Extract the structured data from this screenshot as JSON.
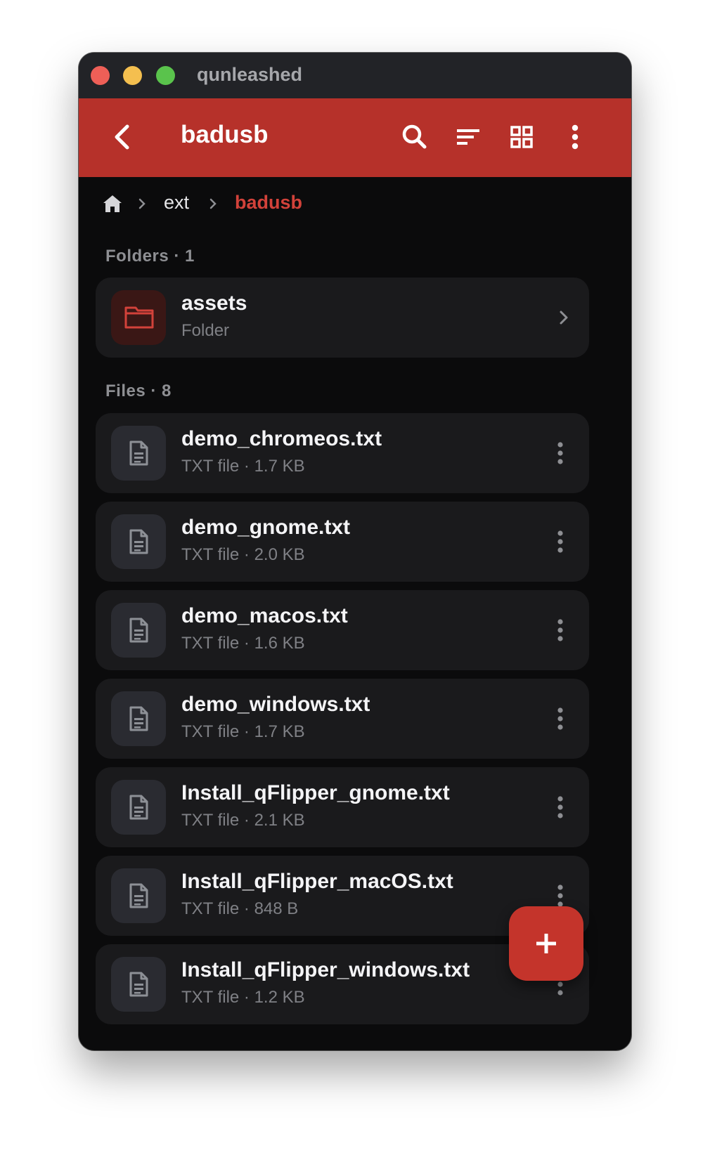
{
  "window": {
    "title": "qunleashed"
  },
  "appbar": {
    "title": "badusb",
    "icons": [
      "back-arrow-icon",
      "search-icon",
      "sort-icon",
      "grid-view-icon",
      "more-vertical-icon"
    ]
  },
  "breadcrumb": {
    "items": [
      "ext",
      "badusb"
    ]
  },
  "folders": {
    "label": "Folders · 1",
    "items": [
      {
        "name": "assets",
        "meta": "Folder"
      }
    ]
  },
  "files": {
    "label": "Files · 8",
    "items": [
      {
        "name": "demo_chromeos.txt",
        "meta": "TXT file · 1.7 KB"
      },
      {
        "name": "demo_gnome.txt",
        "meta": "TXT file · 2.0 KB"
      },
      {
        "name": "demo_macos.txt",
        "meta": "TXT file · 1.6 KB"
      },
      {
        "name": "demo_windows.txt",
        "meta": "TXT file · 1.7 KB"
      },
      {
        "name": "Install_qFlipper_gnome.txt",
        "meta": "TXT file · 2.1 KB"
      },
      {
        "name": "Install_qFlipper_macOS.txt",
        "meta": "TXT file · 848 B"
      },
      {
        "name": "Install_qFlipper_windows.txt",
        "meta": "TXT file · 1.2 KB"
      }
    ]
  },
  "fab": {
    "icon": "plus-icon"
  },
  "colors": {
    "accent": "#b6312a",
    "background": "#0b0b0c",
    "card": "#1a1a1c"
  }
}
